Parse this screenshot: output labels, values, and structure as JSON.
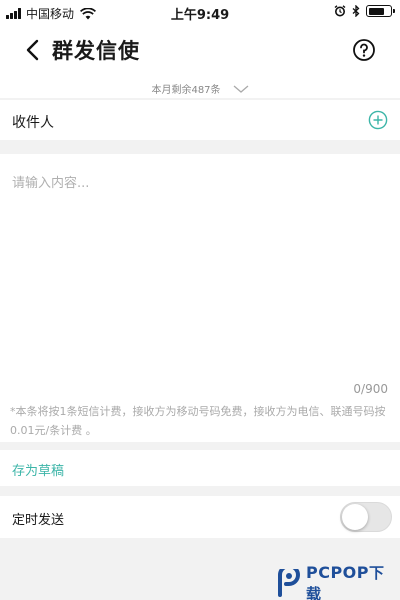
{
  "status_bar": {
    "carrier": "中国移动",
    "time": "上午9:49"
  },
  "nav": {
    "title": "群发信使"
  },
  "quota": {
    "text": "本月剩余487条"
  },
  "recipient": {
    "label": "收件人"
  },
  "compose": {
    "placeholder": "请输入内容...",
    "char_count": "0/900",
    "billing_note": "*本条将按1条短信计费，接收方为移动号码免费，接收方为电信、联通号码按0.01元/条计费 。"
  },
  "draft": {
    "label": "存为草稿"
  },
  "schedule": {
    "label": "定时发送",
    "enabled": false
  },
  "watermark": {
    "brand": "PCPOP",
    "suffix": "下载"
  },
  "colors": {
    "accent": "#3cb5a8",
    "brand": "#1f4f9a",
    "background": "#f2f2f2"
  }
}
